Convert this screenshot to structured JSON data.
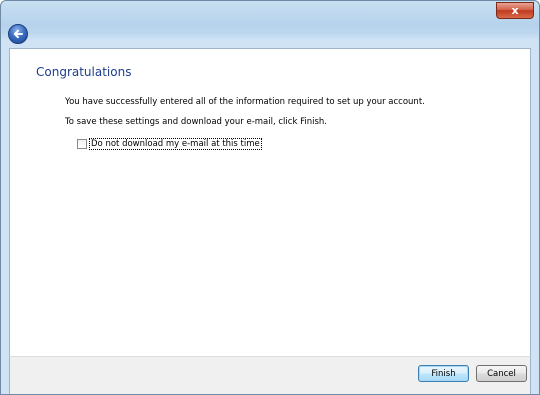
{
  "window": {
    "close_label": "x"
  },
  "nav": {
    "back_icon": "back-arrow-icon"
  },
  "page": {
    "heading": "Congratulations",
    "line1": "You have successfully entered all of the information required to set up your account.",
    "line2": "To save these settings and download your e-mail, click Finish.",
    "checkbox_label": "Do not download my e-mail at this time",
    "checkbox_checked": false
  },
  "footer": {
    "finish_label": "Finish",
    "cancel_label": "Cancel"
  },
  "colors": {
    "heading": "#1e3e8c",
    "close_button": "#c0391f",
    "back_button": "#3b6ec2"
  }
}
